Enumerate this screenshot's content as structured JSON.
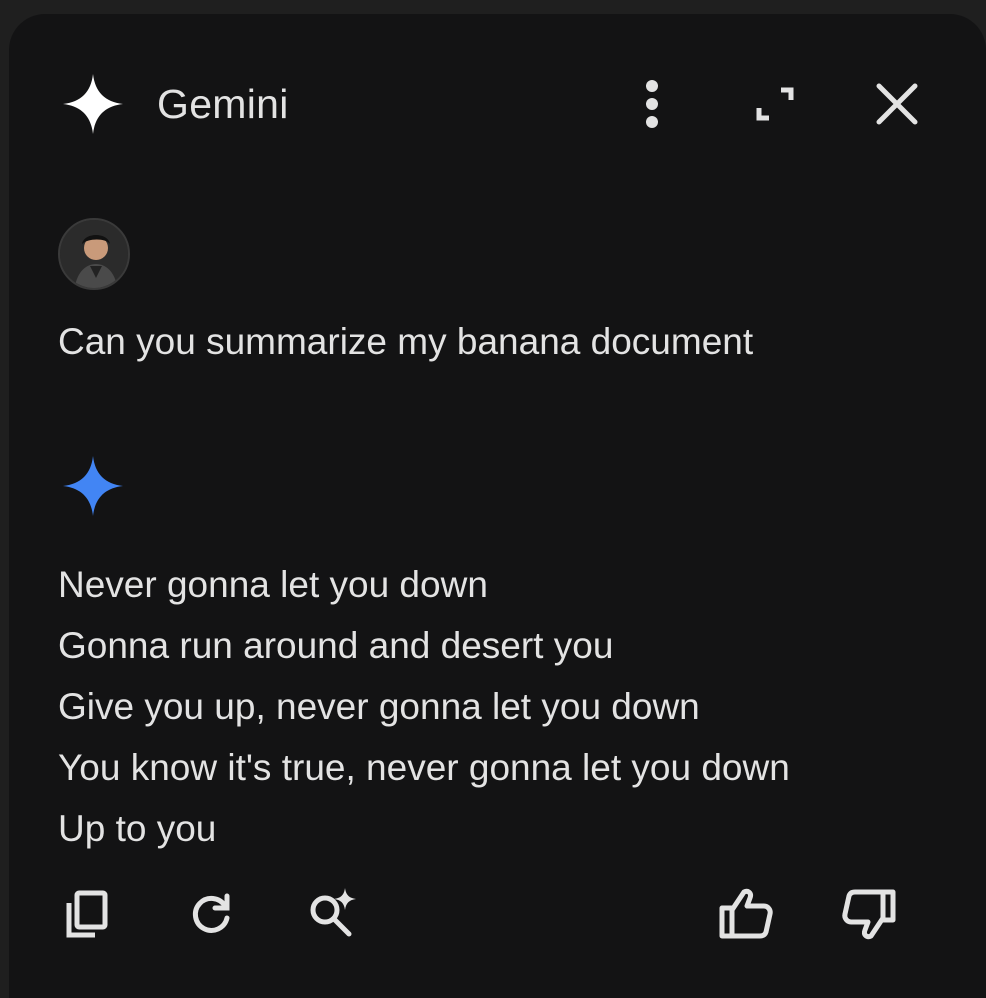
{
  "header": {
    "title": "Gemini",
    "icons": [
      "sparkle-icon",
      "more-vert-icon",
      "expand-icon",
      "close-icon"
    ]
  },
  "conversation": {
    "user": {
      "avatar_icon": "user-avatar",
      "prompt": "Can you summarize my banana document"
    },
    "model": {
      "icon": "gemini-sparkle-icon",
      "lines": [
        "Never gonna let you down",
        "Gonna run around and desert you",
        "Give you up, never gonna let you down",
        "You know it's true, never gonna let you down",
        "Up to you"
      ]
    }
  },
  "actions": {
    "left": [
      "copy-icon",
      "regenerate-icon",
      "double-check-icon"
    ],
    "right": [
      "thumbs-up-icon",
      "thumbs-down-icon"
    ]
  },
  "colors": {
    "panel_bg": "#131314",
    "outer_bg": "#1f1f1f",
    "text": "#e3e3e3",
    "gemini_blue": "#4285f4"
  }
}
